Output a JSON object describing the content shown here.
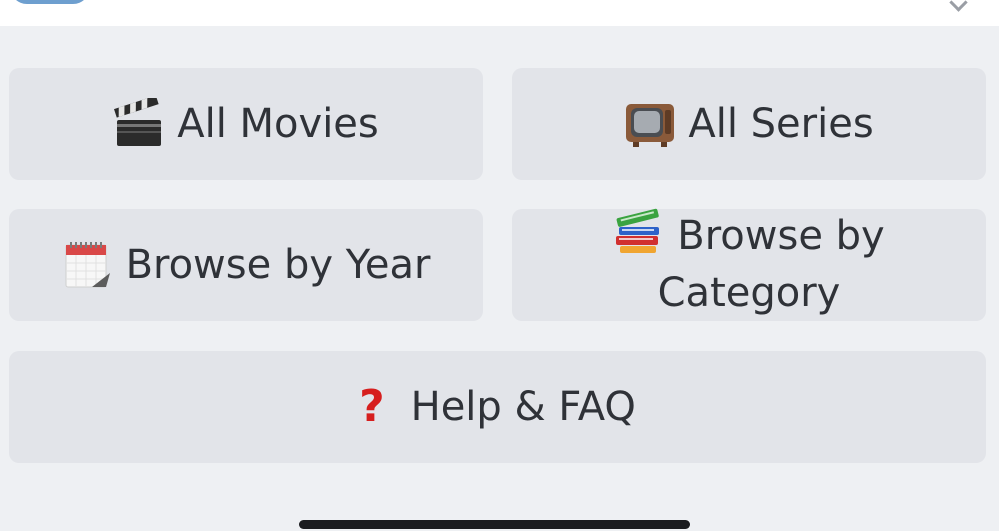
{
  "menu": {
    "all_movies": {
      "icon": "clapperboard-icon",
      "label": "All Movies"
    },
    "all_series": {
      "icon": "television-icon",
      "label": "All Series"
    },
    "browse_year": {
      "icon": "calendar-icon",
      "label": "Browse by Year"
    },
    "browse_category": {
      "icon": "books-icon",
      "label_line1": "Browse by",
      "label_line2": "Category"
    },
    "help": {
      "icon": "question-mark-icon",
      "icon_glyph": "?",
      "label": "Help & FAQ"
    }
  },
  "colors": {
    "background": "#eef0f3",
    "button": "#e2e4e9",
    "text": "#2f3238",
    "help_icon": "#d61e1e"
  }
}
